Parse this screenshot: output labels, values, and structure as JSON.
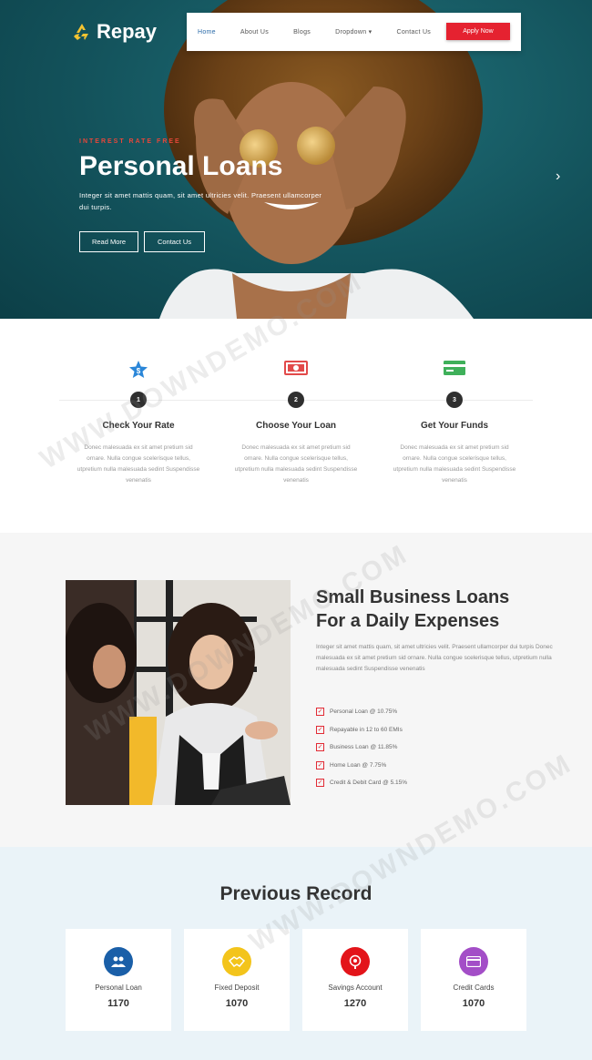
{
  "brand": {
    "name": "Repay",
    "logo_icon": "recycle-icon",
    "logo_color": "#f4c431"
  },
  "nav": {
    "items": [
      "Home",
      "About Us",
      "Blogs",
      "Dropdown",
      "Contact Us"
    ],
    "dropdown_caret": "▾",
    "apply_label": "Apply Now",
    "apply_color": "#e52230"
  },
  "hero": {
    "kicker": "INTEREST RATE FREE",
    "title": "Personal Loans",
    "description": "Integer sit amet mattis quam, sit amet ultricies velit. Praesent ullamcorper dui turpis.",
    "read_more": "Read More",
    "contact": "Contact Us",
    "next_arrow": "›"
  },
  "steps": [
    {
      "number": "1",
      "title": "Check Your Rate",
      "icon": "star-badge-icon",
      "icon_color": "#2a86d8",
      "description": "Donec malesuada ex sit amet pretium sid ornare. Nulla congue scelerisque tellus, utpretium nulla malesuada sedint Suspendisse venenatis"
    },
    {
      "number": "2",
      "title": "Choose Your Loan",
      "icon": "cash-icon",
      "icon_color": "#e24a4a",
      "description": "Donec malesuada ex sit amet pretium sid ornare. Nulla congue scelerisque tellus, utpretium nulla malesuada sedint Suspendisse venenatis"
    },
    {
      "number": "3",
      "title": "Get Your Funds",
      "icon": "card-icon",
      "icon_color": "#3fb05a",
      "description": "Donec malesuada ex sit amet pretium sid ornare. Nulla congue scelerisque tellus, utpretium nulla malesuada sedint Suspendisse venenatis"
    }
  ],
  "business": {
    "title_line1": "Small Business Loans",
    "title_line2": "For a Daily Expenses",
    "description": "Integer sit amet mattis quam, sit amet ultricies velit. Praesent ullamcorper dui turpis Donec malesuada ex sit amet pretium sid ornare. Nulla congue scelerisque tellus, utpretium nulla malesuada sedint Suspendisse venenatis",
    "rates": [
      "Personal Loan @ 10.75%",
      "Repayable in 12 to 60 EMIs",
      "Business Loan @ 11.85%",
      "Home Loan @ 7.75%",
      "Credit & Debit Card @ 5.15%"
    ],
    "check_color": "#e22b35"
  },
  "records": {
    "title": "Previous Record",
    "cards": [
      {
        "label": "Personal Loan",
        "value": "1170",
        "icon": "users-icon",
        "color": "#1a5fa8"
      },
      {
        "label": "Fixed Deposit",
        "value": "1070",
        "icon": "handshake-icon",
        "color": "#f3c41b"
      },
      {
        "label": "Savings Account",
        "value": "1270",
        "icon": "piggy-bank-icon",
        "color": "#e3141a"
      },
      {
        "label": "Credit Cards",
        "value": "1070",
        "icon": "credit-card-icon",
        "color": "#a34ec7"
      }
    ]
  },
  "watermark": "WWW.DOWNDEMO.COM"
}
